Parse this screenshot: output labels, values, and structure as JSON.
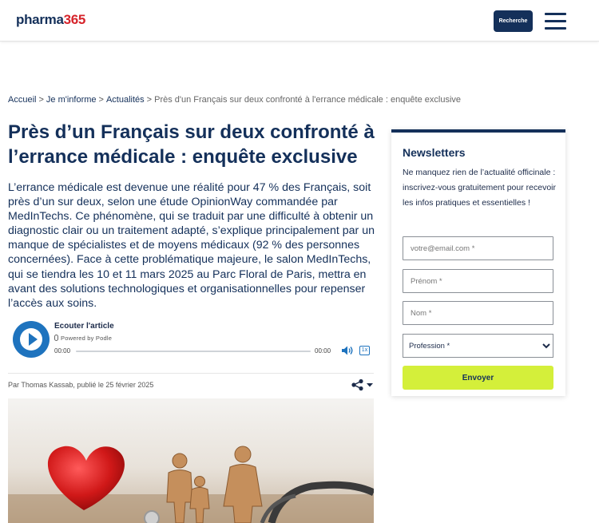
{
  "header": {
    "logo_part1": "pharma",
    "logo_part2": "365",
    "search_button": "Recherche",
    "menu_icon": "hamburger-icon"
  },
  "breadcrumb": {
    "items": [
      "Accueil",
      "Je m'informe",
      "Actualités"
    ],
    "separator": ">",
    "current": "Près d'un Français sur deux confronté à l'errance médicale : enquête exclusive"
  },
  "article": {
    "title": "Près d’un Français sur deux confronté à l’errance médicale : enquête exclusive",
    "lead": "L’errance médicale est devenue une réalité pour 47 % des Français, soit près d’un sur deux, selon une étude OpinionWay commandée par MedInTechs. Ce phénomène, qui se traduit par une difficulté à obtenir un diagnostic clair ou un traitement adapté, s’explique principalement par un manque de spécialistes et de moyens médicaux (92 % des personnes concernées). Face à cette problématique majeure, le salon MedInTechs, qui se tiendra les 10 et 11 mars 2025 au Parc Floral de Paris, mettra en avant des solutions technologiques et organisationnelles pour repenser l’accès aux soins.",
    "byline": "Par Thomas Kassab, publié le 25 février 2025",
    "share_icon": "share-icon"
  },
  "player": {
    "title": "Ecouter l'article",
    "powered_by": "Powered by Podle",
    "current_time": "00:00",
    "duration": "00:00",
    "speed": "1x",
    "progress": 0
  },
  "newsletter": {
    "title": "Newsletters",
    "description": "Ne manquez rien de l’actualité officinale : inscrivez-vous gratuitement pour recevoir les infos pratiques et essentielles !",
    "email_placeholder": "votre@email.com *",
    "firstname_placeholder": "Prénom *",
    "lastname_placeholder": "Nom *",
    "profession_selected": "Profession *",
    "submit_label": "Envoyer"
  },
  "colors": {
    "brand_navy": "#14305a",
    "brand_red": "#d6232a",
    "player_blue": "#1e73be",
    "submit_lime": "#d4ef3a"
  }
}
